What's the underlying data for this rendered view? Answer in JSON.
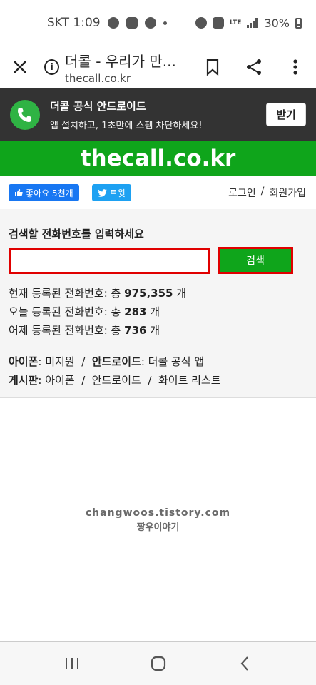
{
  "status_bar": {
    "carrier_time": "SKT 1:09",
    "network": "LTE",
    "battery": "30%"
  },
  "browser": {
    "title": "더콜 - 우리가 만...",
    "url": "thecall.co.kr"
  },
  "app_banner": {
    "title": "더콜 공식 안드로이드",
    "subtitle": "앱 설치하고, 1초만에 스펨 차단하세요!",
    "install_label": "받기",
    "logo_text": "?!"
  },
  "site": {
    "logo": "thecall.co.kr"
  },
  "social": {
    "like_label": "좋아요 5천개",
    "tweet_label": "트윗",
    "login": "로그인",
    "separator": "/",
    "signup": "회원가입"
  },
  "search": {
    "prompt": "검색할 전화번호를 입력하세요",
    "input_value": "",
    "button_label": "검색"
  },
  "stats": {
    "total_label": "현재 등록된 전화번호: 총",
    "total_value": "975,355",
    "today_label": "오늘 등록된 전화번호: 총",
    "today_value": "283",
    "yesterday_label": "어제 등록된 전화번호: 총",
    "yesterday_value": "736",
    "unit": "개"
  },
  "links": {
    "iphone_label": "아이폰",
    "iphone_value": "미지원",
    "android_label": "안드로이드",
    "android_value": "더콜 공식 앱",
    "board_label": "게시판",
    "board_items": [
      "아이폰",
      "안드로이드",
      "화이트 리스트"
    ],
    "separator": "/"
  },
  "watermark": {
    "line1": "changwoos.tistory.com",
    "line2": "짱우이야기"
  },
  "colors": {
    "brand_green": "#0fa51b",
    "highlight_red": "#e00000",
    "banner_dark": "#333333",
    "facebook_blue": "#1877f2",
    "twitter_blue": "#1da1f2"
  }
}
